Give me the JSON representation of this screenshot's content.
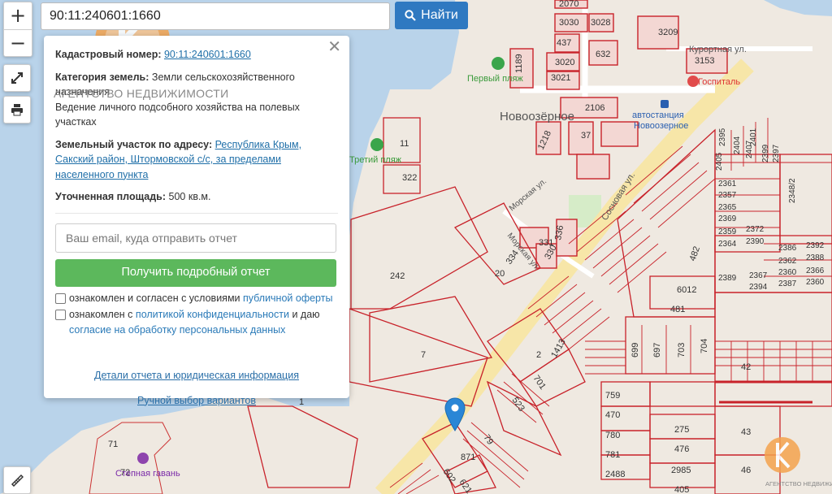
{
  "search": {
    "value": "90:11:240601:1660",
    "button": "Найти"
  },
  "map_controls": {
    "zoom_in": "+",
    "zoom_out": "−"
  },
  "watermark": "АГЕНТСТВО НЕДВИЖИМОСТИ",
  "watermark_small": "АГЕНТСТВО НЕДВИЖИМОСТИ",
  "panel": {
    "cadastral_label": "Кадастровый номер:",
    "cadastral_value": "90:11:240601:1660",
    "category_label": "Категория земель:",
    "category_value": "Земли сельскохозяйственного назначения",
    "usage": "Ведение личного подсобного хозяйства на полевых участках",
    "address_label": "Земельный участок по адресу:",
    "address_value": "Республика Крым, Сакский район, Штормовской с/с, за пределами населенного пункта",
    "area_label": "Уточненная площадь:",
    "area_value": "500 кв.м.",
    "email_placeholder": "Ваш email, куда отправить отчет",
    "report_button": "Получить подробный отчет",
    "consent1_text": "ознакомлен и согласен с условиями",
    "consent1_link": "публичной оферты",
    "consent2_text": "ознакомлен с",
    "consent2_link": "политикой конфиденциальности",
    "consent2_and": "и даю",
    "consent2_link2": "согласие на обработку персональных данных",
    "details_link": "Детали отчета и юридическая информация",
    "manual_link": "Ручной выбор вариантов"
  },
  "map_labels": {
    "settlement": "Новоозёрное",
    "beach1": "Первый пляж",
    "beach3": "Третий пляж",
    "harbor": "Степная гавань",
    "hospital": "Госпиталь",
    "bus": "автостанция Новоозерное",
    "kurortnaya": "Курортная ул.",
    "sosnovaya": "Сосновая ул.",
    "morskaya": "Морская ул.",
    "morskaya2": "Морская ул.",
    "parcels": [
      "2070",
      "3030",
      "3028",
      "3209",
      "437",
      "632",
      "1189",
      "3020",
      "3153",
      "3021",
      "2106",
      "1218",
      "37",
      "11",
      "322",
      "242",
      "20",
      "331",
      "336",
      "334",
      "330",
      "7",
      "2",
      "1413",
      "701",
      "523",
      "871",
      "79",
      "602",
      "621",
      "482",
      "6012",
      "481",
      "699",
      "697",
      "703",
      "704",
      "42",
      "759",
      "470",
      "780",
      "781",
      "2488",
      "275",
      "476",
      "2985",
      "405",
      "43",
      "46",
      "2405",
      "2395",
      "2404",
      "2407",
      "2401",
      "2399",
      "2397",
      "2361",
      "2357",
      "2365",
      "2369",
      "2359",
      "2372",
      "2364",
      "2390",
      "2386",
      "2392",
      "2362",
      "2388",
      "2389",
      "2367",
      "2360",
      "2394",
      "2387",
      "2348/2",
      "71",
      "72",
      "1"
    ]
  }
}
